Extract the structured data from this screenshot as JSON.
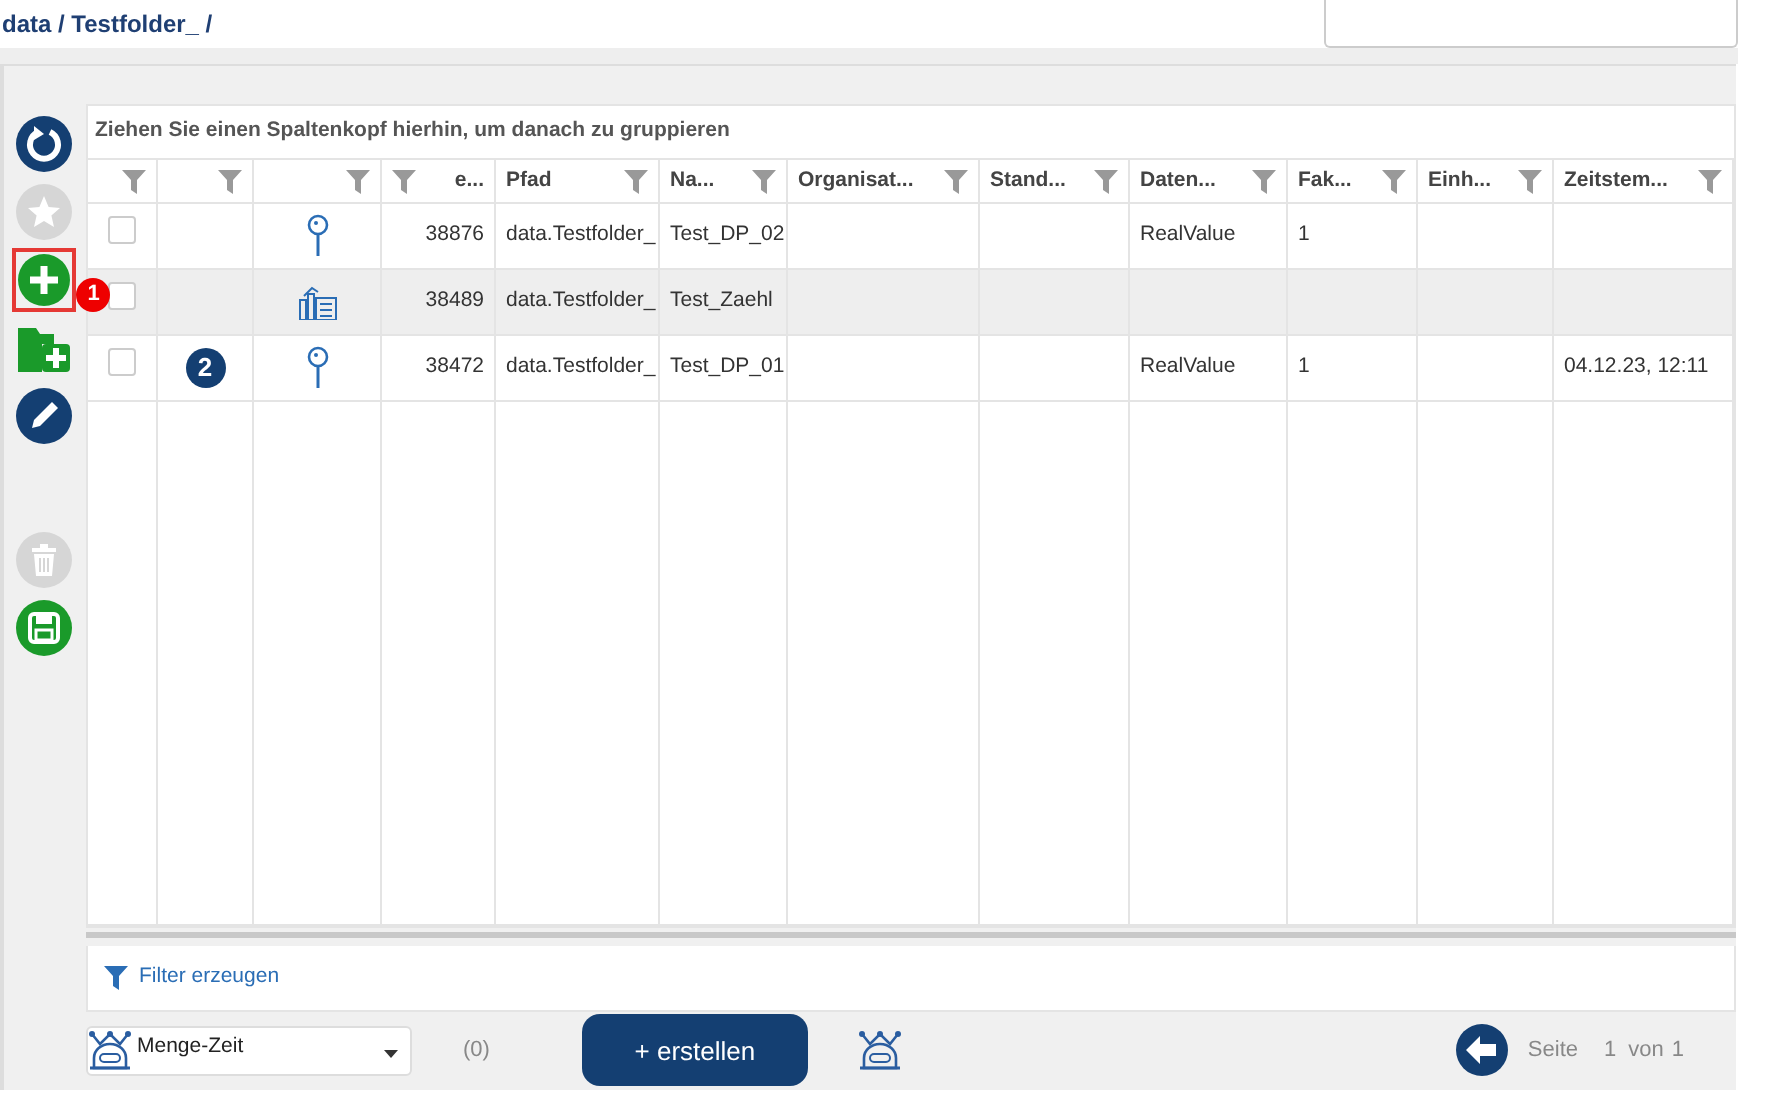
{
  "breadcrumb": "data / Testfolder_ /",
  "toolbar": [
    {
      "kind": "refresh",
      "disabled": false,
      "highlighted": false
    },
    {
      "kind": "favorite",
      "disabled": true,
      "highlighted": false
    },
    {
      "kind": "add",
      "disabled": false,
      "highlighted": true,
      "badge": "1"
    },
    {
      "kind": "add-folder",
      "disabled": false,
      "highlighted": false
    },
    {
      "kind": "edit",
      "disabled": false,
      "highlighted": false
    },
    {
      "kind": "spacer"
    },
    {
      "kind": "delete",
      "disabled": true,
      "highlighted": false
    },
    {
      "kind": "save",
      "disabled": false,
      "highlighted": false
    }
  ],
  "grid": {
    "group_hint": "Ziehen Sie einen Spaltenkopf hierhin, um danach zu gruppieren",
    "columns": [
      {
        "kind": "filter-only"
      },
      {
        "kind": "filter-only"
      },
      {
        "kind": "filter-only"
      },
      {
        "kind": "filter-first",
        "label": "e..."
      },
      {
        "kind": "labeled",
        "label": "Pfad"
      },
      {
        "kind": "labeled",
        "label": "Na..."
      },
      {
        "kind": "labeled",
        "label": "Organisat..."
      },
      {
        "kind": "labeled",
        "label": "Stand..."
      },
      {
        "kind": "labeled",
        "label": "Daten..."
      },
      {
        "kind": "labeled",
        "label": "Fak..."
      },
      {
        "kind": "labeled",
        "label": "Einh..."
      },
      {
        "kind": "labeled",
        "label": "Zeitstem..."
      }
    ],
    "rows": [
      {
        "checked": false,
        "selected": false,
        "kind": "pin",
        "id": "38876",
        "path": "data.Testfolder_",
        "name": "Test_DP_02",
        "data_type": "RealValue",
        "factor": "1"
      },
      {
        "checked": false,
        "selected": true,
        "kind": "meter",
        "id": "38489",
        "path": "data.Testfolder_",
        "name": "Test_Zaehl"
      },
      {
        "checked": false,
        "selected": false,
        "badge": "2",
        "kind": "pin",
        "id": "38472",
        "path": "data.Testfolder_",
        "name": "Test_DP_01",
        "data_type": "RealValue",
        "factor": "1",
        "timestamp": "04.12.23, 12:11"
      }
    ],
    "filter_link": "Filter erzeugen"
  },
  "footer": {
    "select_value": "Menge-Zeit",
    "count": "(0)",
    "create_button": "+ erstellen",
    "page_label": "Seite",
    "page": "1",
    "of_label": "von",
    "page_total": "1"
  }
}
